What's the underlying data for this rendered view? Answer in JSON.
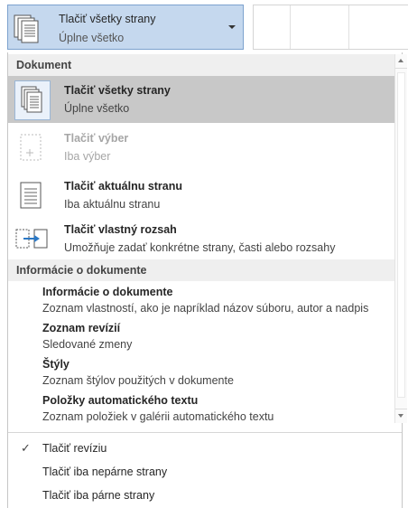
{
  "dropdown": {
    "title": "Tlačiť všetky strany",
    "subtitle": "Úplne všetko",
    "icon": "pages-stack-icon"
  },
  "menu": {
    "sections": {
      "document": "Dokument",
      "info": "Informácie o dokumente"
    },
    "items": [
      {
        "title": "Tlačiť všetky strany",
        "desc": "Úplne všetko",
        "icon": "pages-stack-icon",
        "state": "selected"
      },
      {
        "title": "Tlačiť výber",
        "desc": "Iba výber",
        "icon": "selection-page-icon",
        "state": "disabled"
      },
      {
        "title": "Tlačiť aktuálnu stranu",
        "desc": "Iba aktuálnu stranu",
        "icon": "single-page-icon",
        "state": "normal"
      },
      {
        "title": "Tlačiť vlastný rozsah",
        "desc": "Umožňuje zadať konkrétne strany, časti alebo rozsahy",
        "icon": "page-range-icon",
        "state": "normal"
      }
    ],
    "info_items": [
      {
        "title": "Informácie o dokumente",
        "desc": "Zoznam vlastností, ako je napríklad názov súboru, autor a nadpis"
      },
      {
        "title": "Zoznam revízií",
        "desc": "Sledované zmeny"
      },
      {
        "title": "Štýly",
        "desc": "Zoznam štýlov použitých v dokumente"
      },
      {
        "title": "Položky automatického textu",
        "desc": "Zoznam položiek v galérii automatického textu"
      }
    ],
    "options": [
      {
        "label": "Tlačiť revíziu",
        "checked": true,
        "check_glyph": "✓"
      },
      {
        "label": "Tlačiť iba nepárne strany",
        "checked": false
      },
      {
        "label": "Tlačiť iba párne strany",
        "checked": false
      }
    ]
  },
  "colors": {
    "dropdown_bg": "#c5d8ee",
    "selected_bg": "#c8c8c8",
    "header_bg": "#efefef"
  }
}
